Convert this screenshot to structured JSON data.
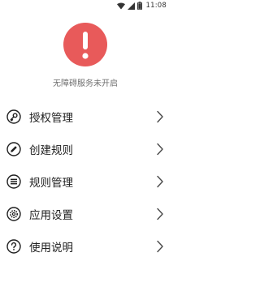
{
  "status_bar": {
    "time": "11:08",
    "icons": [
      "wifi-icon",
      "signal-icon",
      "battery-icon"
    ]
  },
  "hero": {
    "icon": "error-exclamation-icon",
    "accent_color": "#e85a5a",
    "status_text": "无障碍服务未开启"
  },
  "menu": {
    "items": [
      {
        "label": "授权管理",
        "icon": "key-icon"
      },
      {
        "label": "创建规则",
        "icon": "pencil-icon"
      },
      {
        "label": "规则管理",
        "icon": "list-icon"
      },
      {
        "label": "应用设置",
        "icon": "gear-icon"
      },
      {
        "label": "使用说明",
        "icon": "help-icon"
      }
    ],
    "chevron_icon": "chevron-right-icon"
  }
}
